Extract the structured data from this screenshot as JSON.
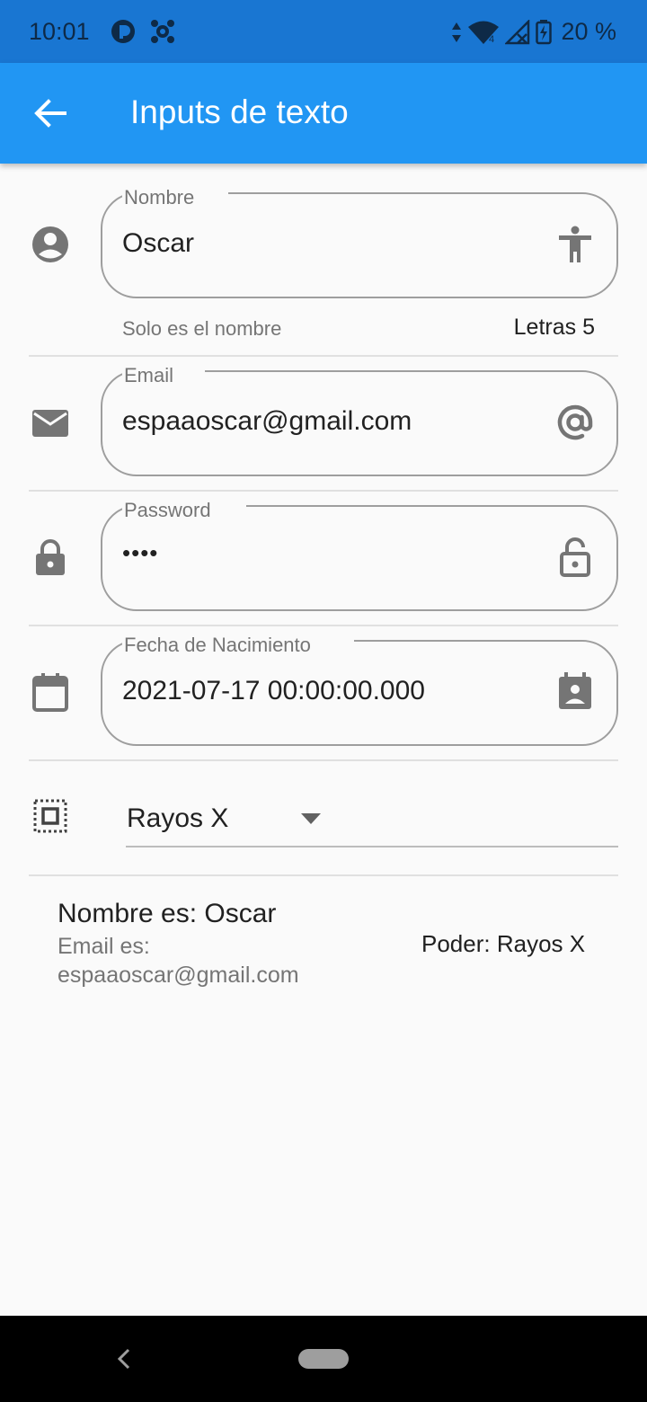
{
  "status_bar": {
    "time": "10:01",
    "battery": "20 %",
    "network_badge": "4",
    "icons": [
      "pocket-casts-icon",
      "network-app-icon",
      "data-arrows-icon",
      "wifi-icon",
      "no-signal-icon",
      "battery-charging-icon"
    ]
  },
  "app_bar": {
    "title": "Inputs de texto",
    "background": "#2196f3"
  },
  "form": {
    "nombre": {
      "label": "Nombre",
      "value": "Oscar",
      "helper": "Solo es el nombre",
      "counter": "Letras 5",
      "leading_icon": "account-circle-icon",
      "trailing_icon": "accessibility-icon"
    },
    "email": {
      "label": "Email",
      "value": "espaaoscar@gmail.com",
      "leading_icon": "email-icon",
      "trailing_icon": "alternate-email-icon"
    },
    "password": {
      "label": "Password",
      "value": "••••",
      "leading_icon": "lock-icon",
      "trailing_icon": "lock-open-icon"
    },
    "fecha": {
      "label": "Fecha de Nacimiento",
      "value": "2021-07-17 00:00:00.000",
      "leading_icon": "calendar-icon",
      "trailing_icon": "perm-contact-calendar-icon"
    },
    "poder": {
      "selected": "Rayos X",
      "leading_icon": "select-all-icon"
    }
  },
  "summary": {
    "name_line": "Nombre es: Oscar",
    "email_line": "Email es: espaaoscar@gmail.com",
    "power_line": "Poder: Rayos X"
  }
}
